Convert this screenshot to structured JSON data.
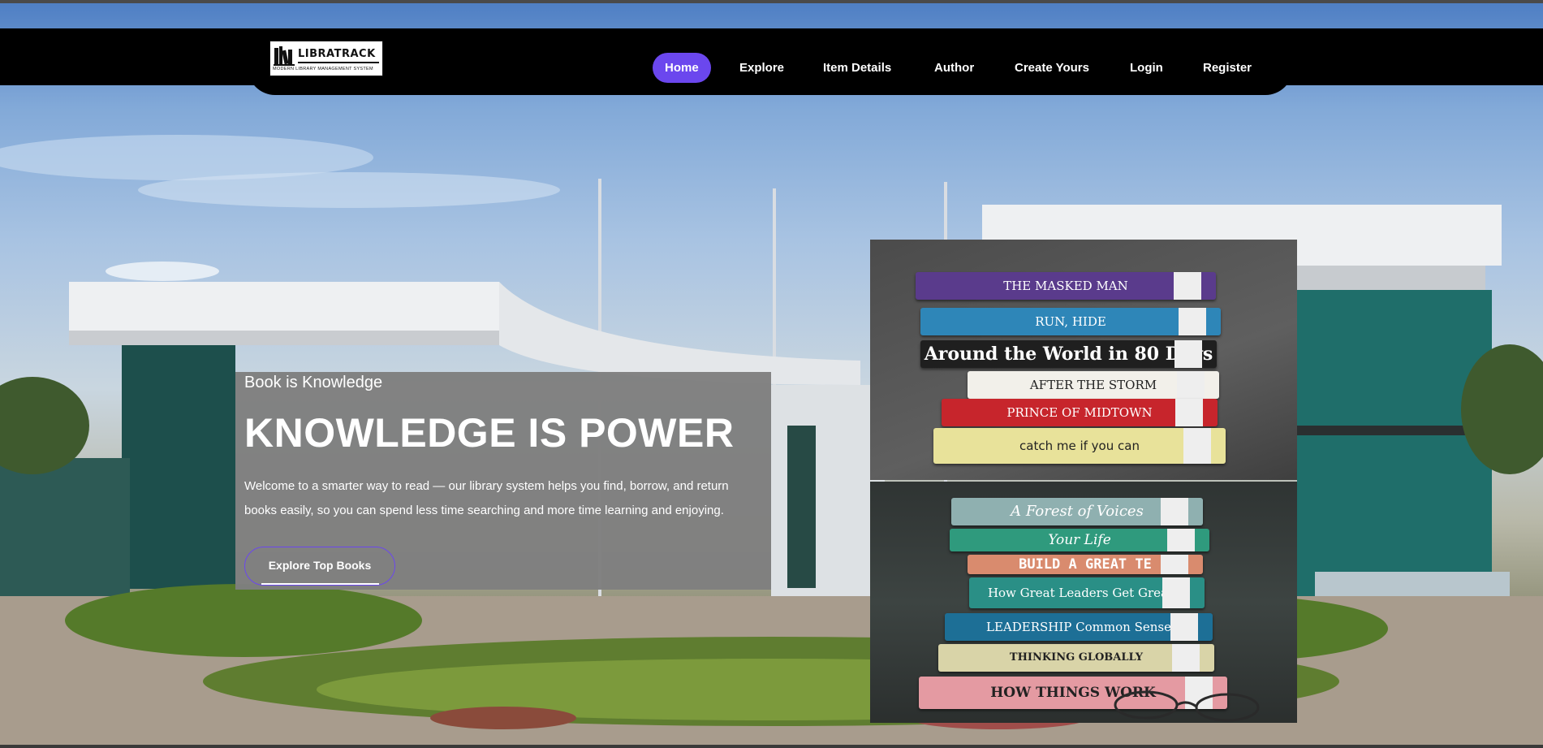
{
  "logo": {
    "name": "LIBRATRACK",
    "tagline": "MODERN LIBRARY MANAGEMENT SYSTEM"
  },
  "nav": {
    "items": [
      "Home",
      "Explore",
      "Item Details",
      "Author",
      "Create Yours",
      "Login",
      "Register"
    ],
    "active": "Home"
  },
  "hero": {
    "subtitle": "Book is Knowledge",
    "headline": "KNOWLEDGE IS POWER",
    "description": "Welcome to a smarter way to read — our library system helps you find, borrow, and return books easily, so you can spend less time searching and more time learning and enjoying.",
    "cta_label": "Explore Top Books"
  },
  "photos": {
    "top_books": [
      {
        "title": "THE MASKED MAN",
        "color": "#5a3b8c"
      },
      {
        "title": "RUN, HIDE",
        "color": "#2e86b8"
      },
      {
        "title": "Around the World in 80 Days",
        "color": "#1f1f1f"
      },
      {
        "title": "AFTER THE STORM",
        "color": "#f2f0ea"
      },
      {
        "title": "PRINCE OF MIDTOWN",
        "color": "#c7252c"
      },
      {
        "title": "catch me if you can",
        "color": "#e8e29a"
      }
    ],
    "bottom_books": [
      {
        "title": "A Forest of Voices",
        "color": "#8fb0b0"
      },
      {
        "title": "Your Life",
        "color": "#2f9a7d"
      },
      {
        "title": "BUILD A GREAT TE",
        "color": "#d98b6e"
      },
      {
        "title": "How Great Leaders Get Great R",
        "color": "#2a8f86"
      },
      {
        "title": "LEADERSHIP Common Sense",
        "color": "#1d6f96"
      },
      {
        "title": "THINKING GLOBALLY",
        "color": "#d9d4a8"
      },
      {
        "title": "HOW THINGS WORK",
        "color": "#e49aa2"
      }
    ]
  },
  "colors": {
    "accent": "#6b47ee",
    "navbar": "#000000",
    "panel": "#7f7f7f"
  }
}
